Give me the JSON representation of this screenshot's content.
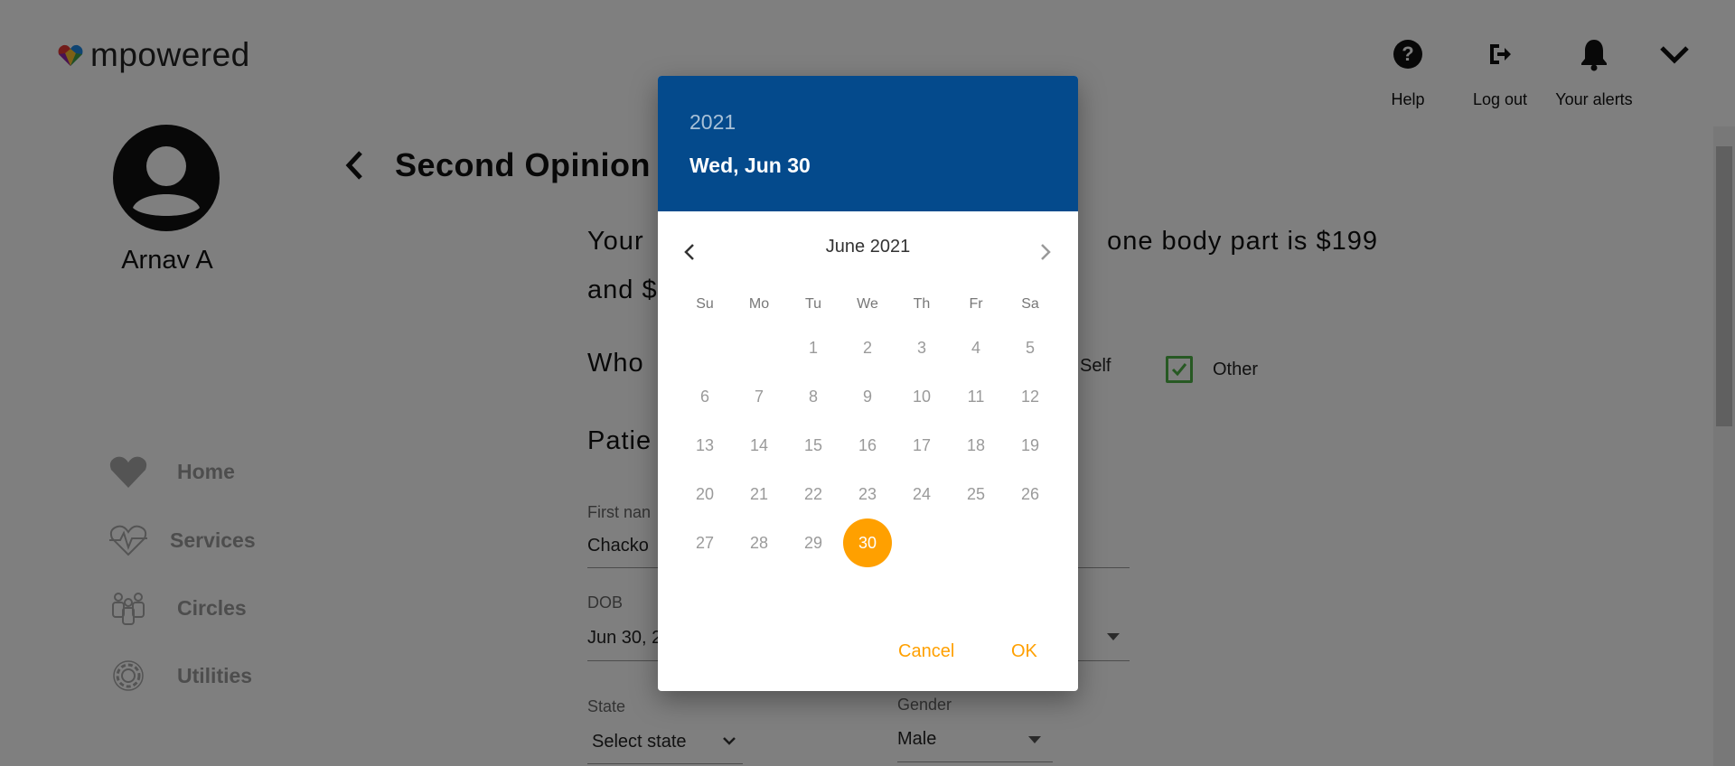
{
  "header": {
    "logo_text": "mpowered",
    "help_label": "Help",
    "logout_label": "Log out",
    "alerts_label": "Your alerts"
  },
  "profile": {
    "name": "Arnav A"
  },
  "nav": {
    "home": "Home",
    "services": "Services",
    "circles": "Circles",
    "utilities": "Utilities"
  },
  "main": {
    "title": "Second Opinion",
    "para_line1_left": "Your",
    "para_line1_right": "one body part is $199",
    "para_line2": "and $",
    "who_label": "Who",
    "opt_self": "Self",
    "opt_other": "Other",
    "section_title": "Patie",
    "first_name_label": "First nan",
    "first_name_value": "Chacko",
    "dob_label": "DOB",
    "dob_value": "Jun 30, 2",
    "state_label": "State",
    "state_value": "Select state",
    "gender_label": "Gender",
    "gender_value": "Male"
  },
  "datepicker": {
    "year": "2021",
    "selected_date": "Wed, Jun 30",
    "month_label": "June 2021",
    "weekdays": [
      "Su",
      "Mo",
      "Tu",
      "We",
      "Th",
      "Fr",
      "Sa"
    ],
    "first_weekday_index": 2,
    "days_in_month": 30,
    "selected_day": 30,
    "cancel_label": "Cancel",
    "ok_label": "OK"
  },
  "colors": {
    "header_blue": "#044a8c",
    "accent_orange": "#ffa000",
    "checkbox_green": "#4fb347"
  }
}
